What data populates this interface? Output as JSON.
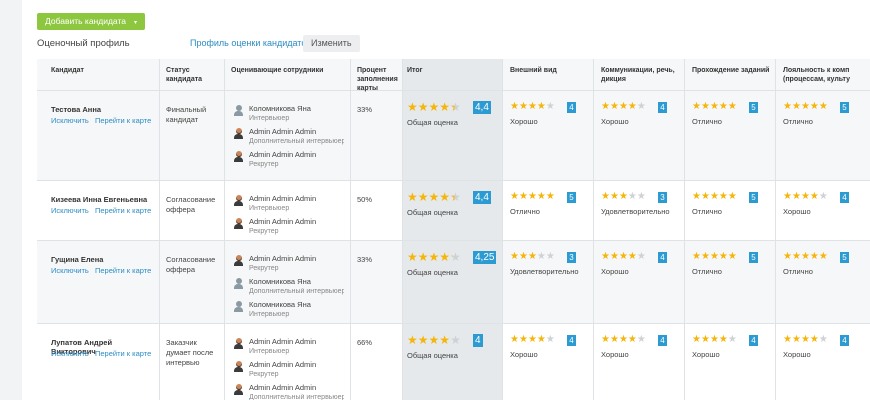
{
  "toolbar": {
    "add_label": "Добавить кандидата",
    "add_caret": "▾"
  },
  "profile": {
    "label": "Оценочный профиль",
    "link": "Профиль оценки кандидатов",
    "change_label": "Изменить"
  },
  "columns": [
    "Кандидат",
    "Статус кандидата",
    "Оценивающие сотрудники",
    "Процент заполнения карты",
    "Итог",
    "Внешний вид",
    "Коммуникации, речь, дикция",
    "Прохождение заданий",
    "Лояльность к комп (процессам, культу"
  ],
  "links": {
    "exclude": "Исключить",
    "go_to_card": "Перейти к карте"
  },
  "overall_label": "Общая оценка",
  "rows": [
    {
      "name": "Тестова Анна",
      "status": "Финальный кандидат",
      "percent": "33%",
      "evaluators": [
        {
          "name": "Коломникова Яна",
          "role": "Интервьюер",
          "avatar": "woman"
        },
        {
          "name": "Admin Admin Admin",
          "role": "Дополнительный интервьюер",
          "avatar": "man"
        },
        {
          "name": "Admin Admin Admin",
          "role": "Рекрутер",
          "avatar": "man"
        }
      ],
      "total": {
        "stars": 4.4,
        "value": "4,4"
      },
      "scores": [
        {
          "stars": 4,
          "value": "4",
          "grade": "Хорошо"
        },
        {
          "stars": 4,
          "value": "4",
          "grade": "Хорошо"
        },
        {
          "stars": 5,
          "value": "5",
          "grade": "Отлично"
        },
        {
          "stars": 5,
          "value": "5",
          "grade": "Отлично"
        }
      ]
    },
    {
      "name": "Кизеева Инна Евгеньевна",
      "status": "Согласование оффера",
      "percent": "50%",
      "evaluators": [
        {
          "name": "Admin Admin Admin",
          "role": "Интервьюер",
          "avatar": "man"
        },
        {
          "name": "Admin Admin Admin",
          "role": "Рекрутер",
          "avatar": "man"
        }
      ],
      "total": {
        "stars": 4.4,
        "value": "4,4"
      },
      "scores": [
        {
          "stars": 5,
          "value": "5",
          "grade": "Отлично"
        },
        {
          "stars": 3,
          "value": "3",
          "grade": "Удовлетворительно"
        },
        {
          "stars": 5,
          "value": "5",
          "grade": "Отлично"
        },
        {
          "stars": 4,
          "value": "4",
          "grade": "Хорошо"
        }
      ]
    },
    {
      "name": "Гущина Елена",
      "status": "Согласование оффера",
      "percent": "33%",
      "evaluators": [
        {
          "name": "Admin Admin Admin",
          "role": "Рекрутер",
          "avatar": "man"
        },
        {
          "name": "Коломникова Яна",
          "role": "Дополнительный интервьюер",
          "avatar": "woman"
        },
        {
          "name": "Коломникова Яна",
          "role": "Интервьюер",
          "avatar": "woman"
        }
      ],
      "total": {
        "stars": 4.25,
        "value": "4,25"
      },
      "scores": [
        {
          "stars": 3,
          "value": "3",
          "grade": "Удовлетворительно"
        },
        {
          "stars": 4,
          "value": "4",
          "grade": "Хорошо"
        },
        {
          "stars": 5,
          "value": "5",
          "grade": "Отлично"
        },
        {
          "stars": 5,
          "value": "5",
          "grade": "Отлично"
        }
      ]
    },
    {
      "name": "Лупатов Андрей Викторович",
      "status": "Заказчик думает после интервью",
      "percent": "66%",
      "evaluators": [
        {
          "name": "Admin Admin Admin",
          "role": "Интервьюер",
          "avatar": "man"
        },
        {
          "name": "Admin Admin Admin",
          "role": "Рекрутер",
          "avatar": "man"
        },
        {
          "name": "Admin Admin Admin",
          "role": "Дополнительный интервьюер",
          "avatar": "man"
        }
      ],
      "total": {
        "stars": 4,
        "value": "4"
      },
      "scores": [
        {
          "stars": 4,
          "value": "4",
          "grade": "Хорошо"
        },
        {
          "stars": 4,
          "value": "4",
          "grade": "Хорошо"
        },
        {
          "stars": 4,
          "value": "4",
          "grade": "Хорошо"
        },
        {
          "stars": 4,
          "value": "4",
          "grade": "Хорошо"
        }
      ]
    }
  ],
  "colors": {
    "accent": "#2b9bd1",
    "star": "#f5b50a",
    "star_off": "#cfd2d5",
    "add_button": "#8dc63f",
    "link": "#2b8cc4"
  }
}
